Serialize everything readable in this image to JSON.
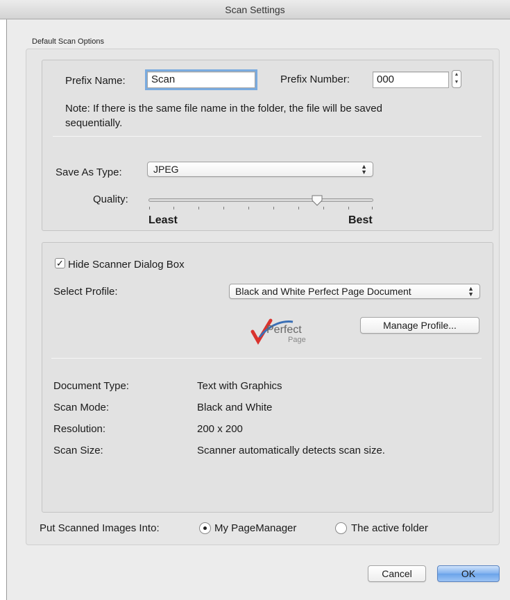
{
  "window": {
    "title": "Scan Settings"
  },
  "group": {
    "label": "Default Scan Options"
  },
  "prefix": {
    "name_label": "Prefix Name:",
    "name_value": "Scan",
    "number_label": "Prefix Number:",
    "number_value": "000",
    "note": "Note: If there is the same file name in the folder, the file will be saved",
    "note_line2": "sequentially."
  },
  "save": {
    "type_label": "Save As Type:",
    "type_value": "JPEG",
    "quality_label": "Quality:",
    "quality_min": "Least",
    "quality_max": "Best",
    "quality_level": 0.75
  },
  "profile": {
    "hide_dialog_label": "Hide Scanner Dialog Box",
    "hide_dialog_checked": true,
    "select_label": "Select Profile:",
    "select_value": "Black and White Perfect Page Document",
    "logo_text_1": "Perfect",
    "logo_text_2": "Page",
    "manage_button": "Manage Profile..."
  },
  "details": [
    {
      "label": "Document Type:",
      "value": "Text with Graphics"
    },
    {
      "label": "Scan Mode:",
      "value": "Black and White"
    },
    {
      "label": "Resolution:",
      "value": "200 x 200"
    },
    {
      "label": "Scan Size:",
      "value": "Scanner automatically detects scan size."
    }
  ],
  "destination": {
    "label": "Put Scanned Images Into:",
    "option_1": "My PageManager",
    "option_2": "The active folder",
    "selected": "My PageManager"
  },
  "buttons": {
    "cancel": "Cancel",
    "ok": "OK"
  },
  "colors": {
    "focus_ring": "#7aabdf",
    "default_button": "#6aa3ea",
    "logo_red": "#d9332e",
    "logo_blue": "#3a6fb5"
  }
}
